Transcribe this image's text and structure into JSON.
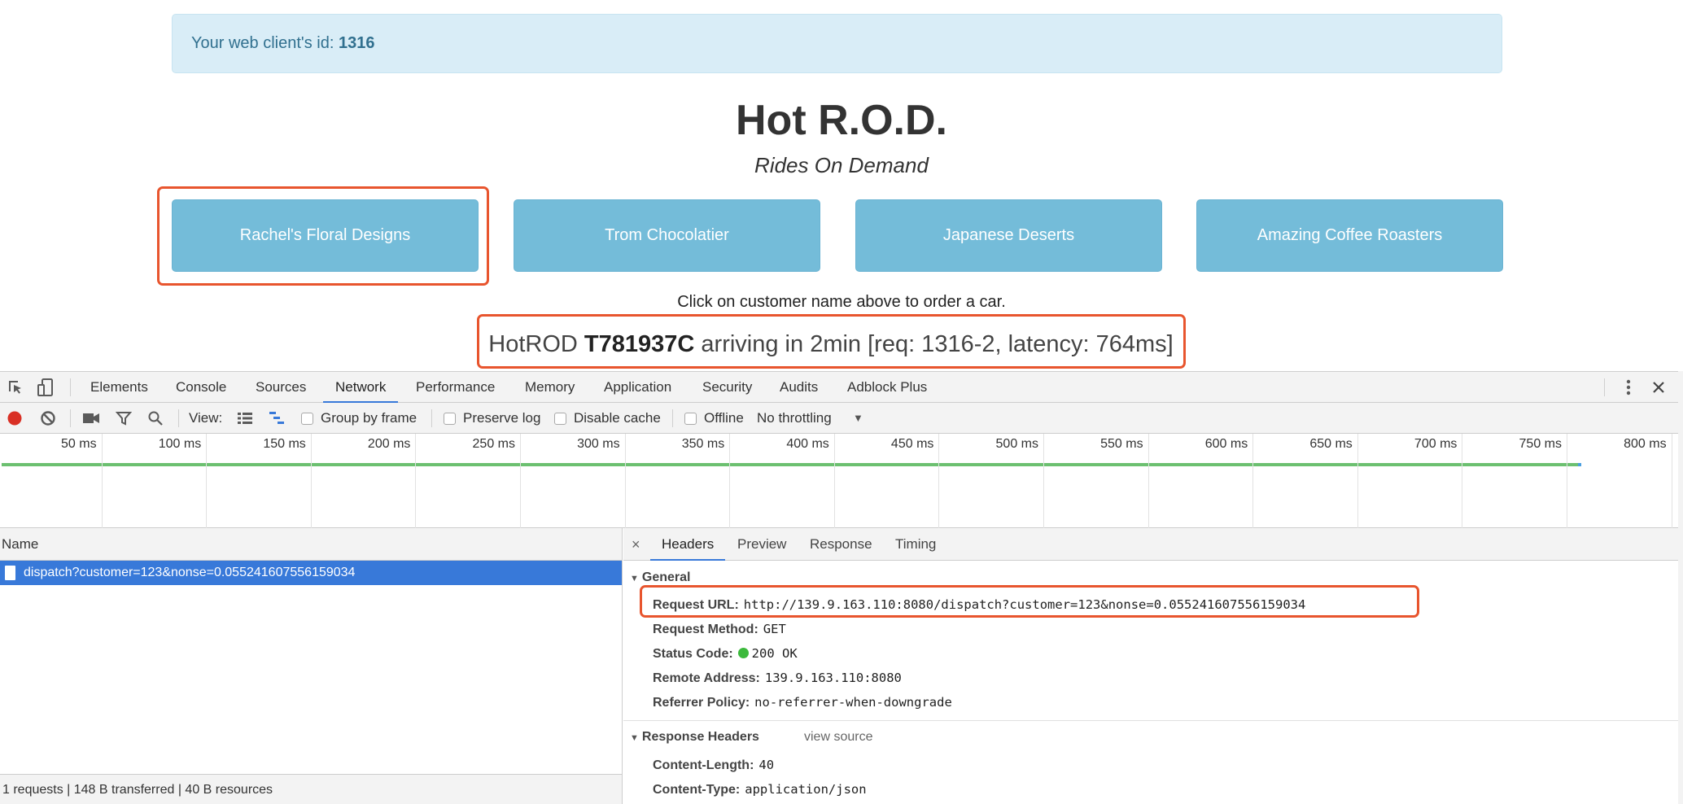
{
  "app": {
    "alert": {
      "prefix": "Your web client's id: ",
      "client_id": "1316"
    },
    "title": "Hot R.O.D.",
    "subtitle": "Rides On Demand",
    "customers": [
      {
        "label": "Rachel's Floral Designs",
        "highlighted": true
      },
      {
        "label": "Trom Chocolatier",
        "highlighted": false
      },
      {
        "label": "Japanese Deserts",
        "highlighted": false
      },
      {
        "label": "Amazing Coffee Roasters",
        "highlighted": false
      }
    ],
    "hint": "Click on customer name above to order a car.",
    "arrival": {
      "prefix": "HotROD ",
      "car_id": "T781937C",
      "suffix": " arriving in 2min [req: 1316-2, latency: 764ms]"
    },
    "colors": {
      "button": "#74bcd9",
      "alert_bg": "#d9edf7",
      "highlight": "#e8552e"
    }
  },
  "devtools": {
    "tabs": [
      {
        "label": "Elements",
        "active": false
      },
      {
        "label": "Console",
        "active": false
      },
      {
        "label": "Sources",
        "active": false
      },
      {
        "label": "Network",
        "active": true
      },
      {
        "label": "Performance",
        "active": false
      },
      {
        "label": "Memory",
        "active": false
      },
      {
        "label": "Application",
        "active": false
      },
      {
        "label": "Security",
        "active": false
      },
      {
        "label": "Audits",
        "active": false
      },
      {
        "label": "Adblock Plus",
        "active": false
      }
    ],
    "toolbar": {
      "view_label": "View:",
      "group_by_frame": {
        "label": "Group by frame",
        "checked": false
      },
      "preserve_log": {
        "label": "Preserve log",
        "checked": false
      },
      "disable_cache": {
        "label": "Disable cache",
        "checked": false
      },
      "offline": {
        "label": "Offline",
        "checked": false
      },
      "throttling": "No throttling"
    },
    "timeline": {
      "ticks": [
        "50 ms",
        "100 ms",
        "150 ms",
        "200 ms",
        "250 ms",
        "300 ms",
        "350 ms",
        "400 ms",
        "450 ms",
        "500 ms",
        "550 ms",
        "600 ms",
        "650 ms",
        "700 ms",
        "750 ms",
        "800 ms"
      ],
      "request_duration_ms": 764
    },
    "requests": {
      "column_name": "Name",
      "items": [
        {
          "name": "dispatch?customer=123&nonse=0.055241607556159034",
          "selected": true
        }
      ],
      "summary": "1 requests | 148 B transferred | 40 B resources"
    },
    "detail": {
      "close": "×",
      "tabs": [
        {
          "label": "Headers",
          "active": true
        },
        {
          "label": "Preview",
          "active": false
        },
        {
          "label": "Response",
          "active": false
        },
        {
          "label": "Timing",
          "active": false
        }
      ],
      "general": {
        "title": "General",
        "request_url": {
          "key": "Request URL:",
          "value": "http://139.9.163.110:8080/dispatch?customer=123&nonse=0.055241607556159034"
        },
        "request_method": {
          "key": "Request Method:",
          "value": "GET"
        },
        "status_code": {
          "key": "Status Code:",
          "value": "200 OK",
          "status_color": "#3cb93c"
        },
        "remote_address": {
          "key": "Remote Address:",
          "value": "139.9.163.110:8080"
        },
        "referrer_policy": {
          "key": "Referrer Policy:",
          "value": "no-referrer-when-downgrade"
        }
      },
      "response_headers": {
        "title": "Response Headers",
        "view_source": "view source",
        "content_length": {
          "key": "Content-Length:",
          "value": "40"
        },
        "content_type": {
          "key": "Content-Type:",
          "value": "application/json"
        }
      }
    }
  }
}
